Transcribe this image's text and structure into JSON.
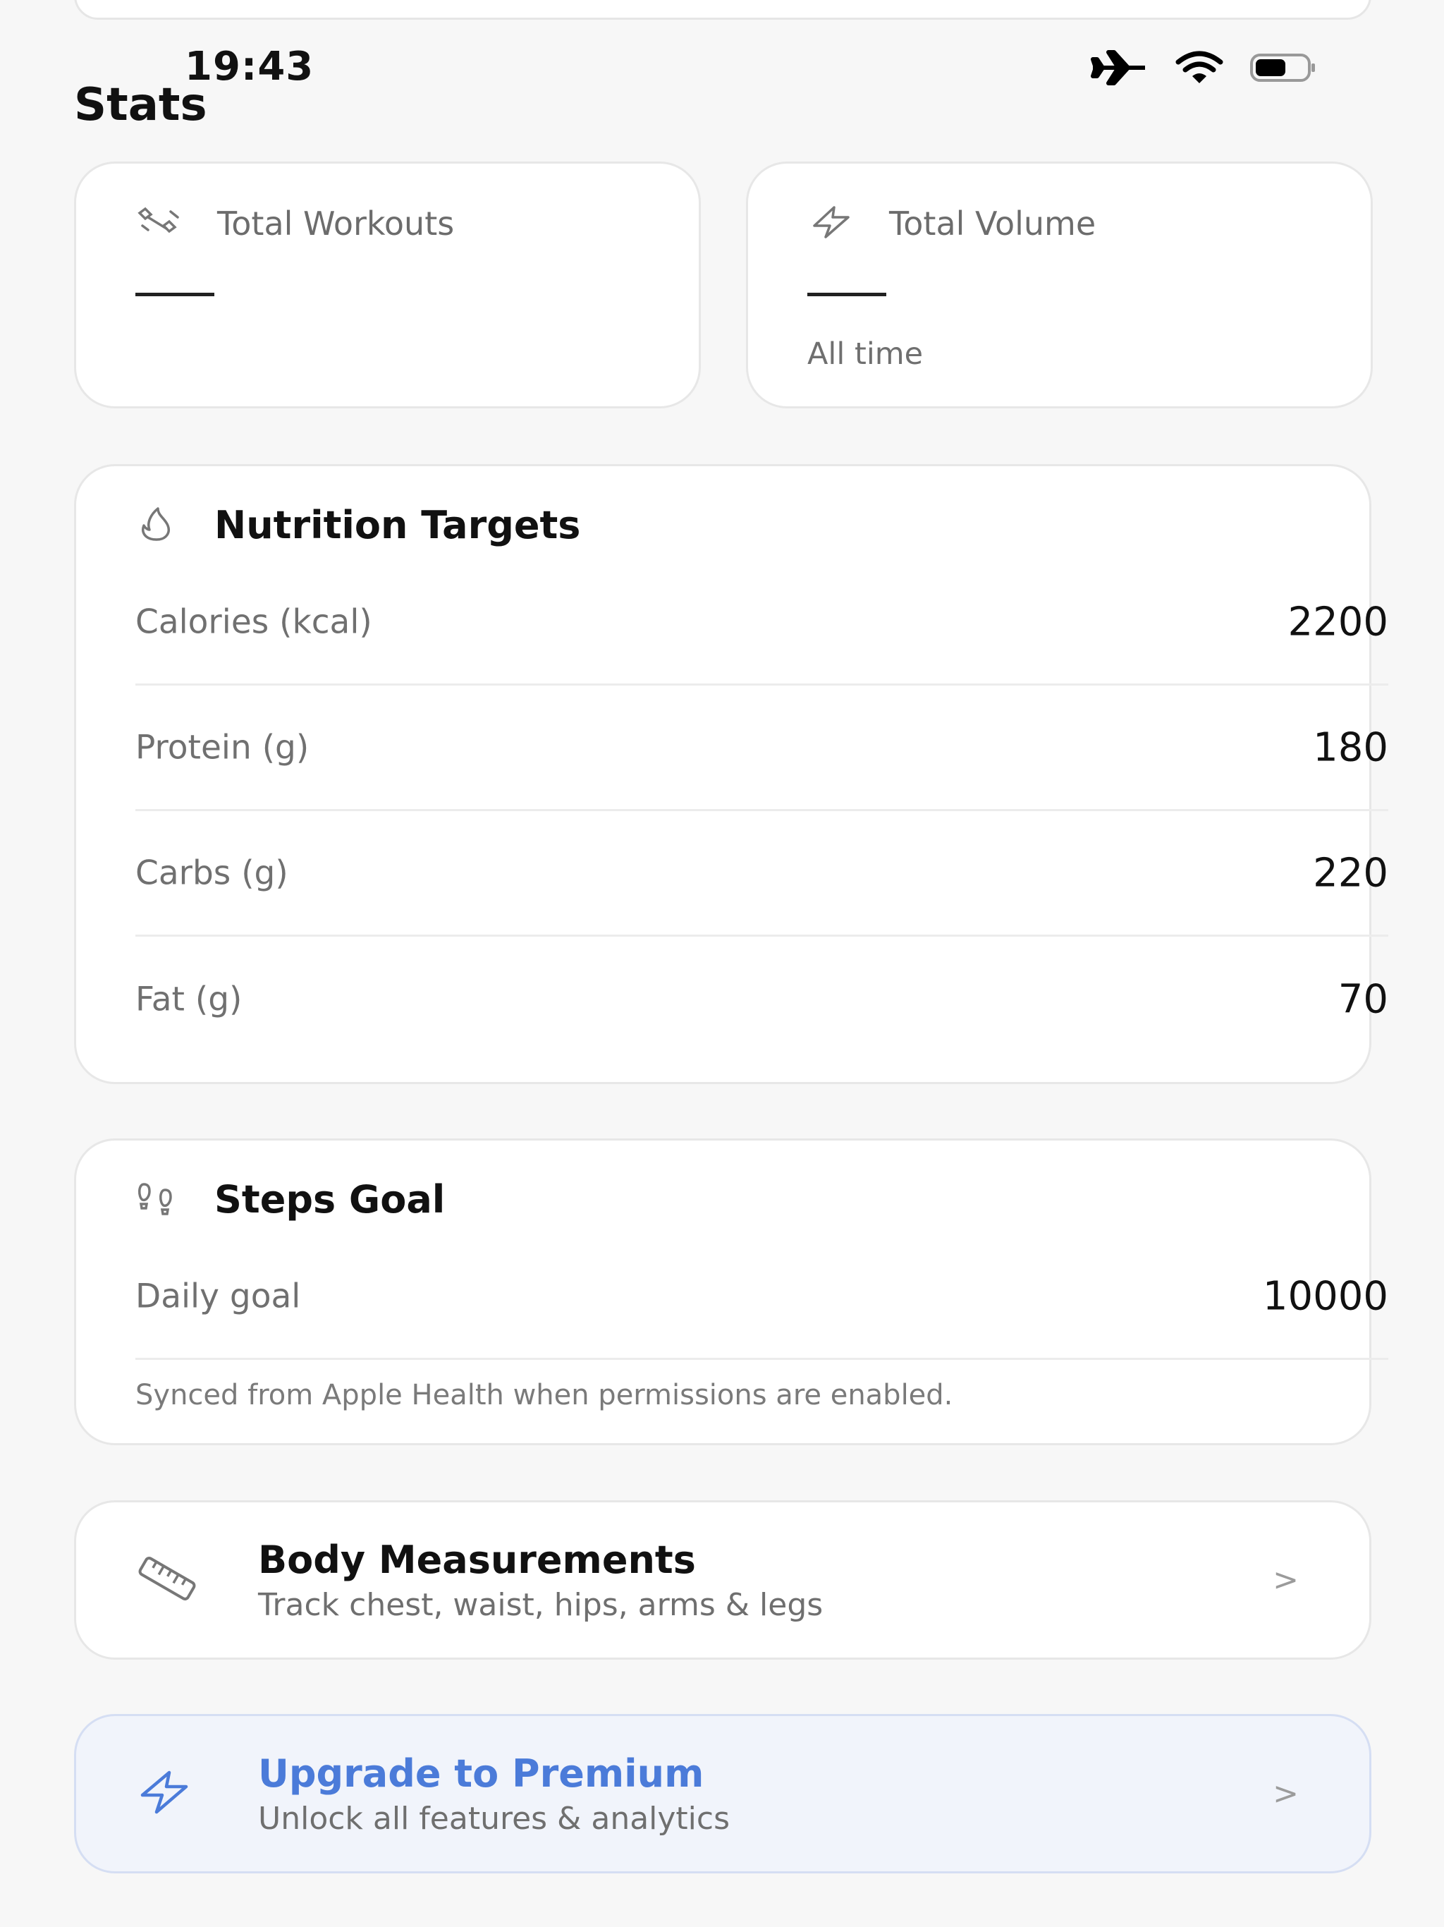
{
  "status_bar": {
    "time": "19:43"
  },
  "page": {
    "title": "Stats"
  },
  "stat_cards": [
    {
      "icon": "dumbbell-icon",
      "label": "Total Workouts",
      "value": "—",
      "sub": ""
    },
    {
      "icon": "lightning-icon",
      "label": "Total Volume",
      "value": "—",
      "sub": "All time"
    }
  ],
  "nutrition": {
    "title": "Nutrition Targets",
    "icon": "flame-icon",
    "rows": [
      {
        "label": "Calories (kcal)",
        "value": "2200"
      },
      {
        "label": "Protein (g)",
        "value": "180"
      },
      {
        "label": "Carbs (g)",
        "value": "220"
      },
      {
        "label": "Fat (g)",
        "value": "70"
      }
    ]
  },
  "steps": {
    "title": "Steps Goal",
    "icon": "footprints-icon",
    "label": "Daily goal",
    "value": "10000",
    "note": "Synced from Apple Health when permissions are enabled."
  },
  "body_measurements": {
    "title": "Body Measurements",
    "subtitle": "Track chest, waist, hips, arms & legs",
    "icon": "ruler-icon"
  },
  "premium": {
    "title": "Upgrade to Premium",
    "subtitle": "Unlock all features & analytics",
    "icon": "lightning-icon"
  },
  "colors": {
    "background": "#f7f7f7",
    "card": "#ffffff",
    "accent": "#4b7bd9",
    "premium_bg": "#f1f4fb"
  }
}
